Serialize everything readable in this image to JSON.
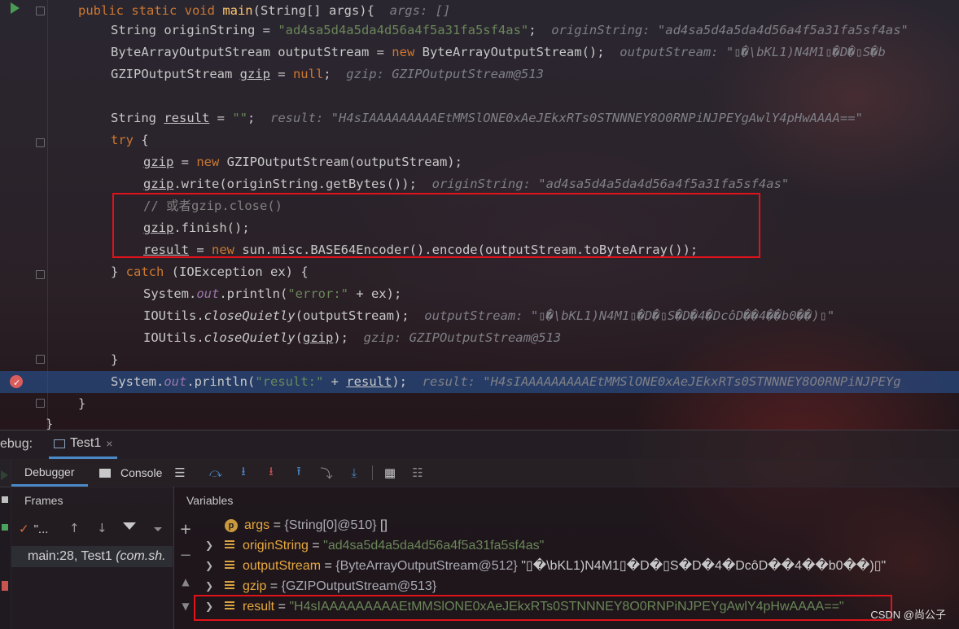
{
  "code": {
    "line0": {
      "kw": "public static void ",
      "fn": "main",
      "rest": "(String[] args){  ",
      "hint": "args: []"
    },
    "line1": {
      "a": "String originString = ",
      "str": "\"ad4sa5d4a5da4d56a4f5a31fa5sf4as\"",
      "b": ";  ",
      "hint": "originString: \"ad4sa5d4a5da4d56a4f5a31fa5sf4as\""
    },
    "line2": {
      "a": "ByteArrayOutputStream outputStream = ",
      "kw": "new",
      "b": " ByteArrayOutputStream();  ",
      "hint": "outputStream: \"▯�\\bKL1)N4M1▯�D�▯S�b"
    },
    "line3": {
      "a": "GZIPOutputStream ",
      "var": "gzip",
      "b": " = ",
      "kw": "null",
      "c": ";  ",
      "hint": "gzip: GZIPOutputStream@513"
    },
    "line5": {
      "a": "String ",
      "var": "result",
      "b": " = ",
      "str": "\"\"",
      "c": ";  ",
      "hint": "result: \"H4sIAAAAAAAAAEtMMSlONE0xAeJEkxRTs0STNNNEY8O0RNPiNJPEYgAwlY4pHwAAAA==\""
    },
    "line6": {
      "kw": "try",
      "rest": " {"
    },
    "line7": {
      "var": "gzip",
      "a": " = ",
      "kw": "new",
      "b": " GZIPOutputStream(outputStream);"
    },
    "line8": {
      "var": "gzip",
      "a": ".write(originString.getBytes());  ",
      "hint": "originString: \"ad4sa5d4a5da4d56a4f5a31fa5sf4as\""
    },
    "line9": {
      "cmt": "// 或者gzip.close()"
    },
    "line10": {
      "var": "gzip",
      "a": ".finish();"
    },
    "line11": {
      "var": "result",
      "a": " = ",
      "kw": "new",
      "b": " sun.misc.BASE64Encoder().encode(outputStream.toByteArray());"
    },
    "line12": {
      "a": "} ",
      "kw": "catch",
      "b": " (IOException ex) {"
    },
    "line13": {
      "a": "System.",
      "field": "out",
      "b": ".println(",
      "str": "\"error:\"",
      "c": " + ex);"
    },
    "line14": {
      "a": "IOUtils.",
      "it": "closeQuietly",
      "b": "(outputStream);  ",
      "hint": "outputStream: \"▯�\\bKL1)N4M1▯�D�▯S�D�4�DcôD��4��b0��)▯\""
    },
    "line15": {
      "a": "IOUtils.",
      "it": "closeQuietly",
      "b": "(",
      "var": "gzip",
      "c": ");  ",
      "hint": "gzip: GZIPOutputStream@513"
    },
    "line16": {
      "a": "}"
    },
    "line17": {
      "a": "System.",
      "field": "out",
      "b": ".println(",
      "str": "\"result:\"",
      "c": " + ",
      "var": "result",
      "d": ");  ",
      "hint": "result: \"H4sIAAAAAAAAAEtMMSlONE0xAeJEkxRTs0STNNNEY8O0RNPiNJPEYg"
    },
    "line18": {
      "a": "}"
    },
    "line19": {
      "a": "}"
    }
  },
  "debug": {
    "label": "ebug:",
    "tab": "Test1",
    "close": "×"
  },
  "toolbar": {
    "debugger": "Debugger",
    "console": "Console"
  },
  "frames": {
    "header": "Frames",
    "thread": "\"...",
    "frame": "main:28, Test1 ",
    "frame_pkg": "(com.sh."
  },
  "variables": {
    "header": "Variables",
    "items": [
      {
        "name": "args",
        "eq": " = ",
        "type": "{String[0]@510} ",
        "value": "[]"
      },
      {
        "name": "originString",
        "eq": " = ",
        "type": "",
        "value": "\"ad4sa5d4a5da4d56a4f5a31fa5sf4as\""
      },
      {
        "name": "outputStream",
        "eq": " = ",
        "type": "{ByteArrayOutputStream@512} ",
        "value": "\"▯�\\bKL1)N4M1▯�D�▯S�D�4�DcôD��4��b0��)▯\""
      },
      {
        "name": "gzip",
        "eq": " = ",
        "type": "{GZIPOutputStream@513}",
        "value": ""
      },
      {
        "name": "result",
        "eq": " = ",
        "type": "",
        "value": "\"H4sIAAAAAAAAAEtMMSlONE0xAeJEkxRTs0STNNNEY8O0RNPiNJPEYgAwlY4pHwAAAA==\""
      }
    ]
  },
  "watermark": "CSDN @尚公子"
}
